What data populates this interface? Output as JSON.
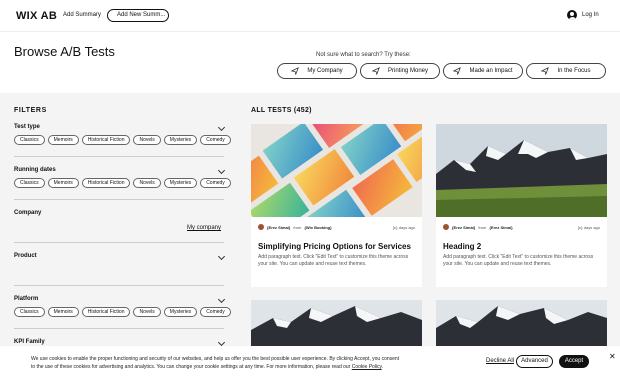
{
  "header": {
    "logo": "WIX AB",
    "add_summary": "Add Summary",
    "add_new_summary": "Add New Summ...",
    "login": "Log In"
  },
  "page": {
    "title": "Browse A/B Tests",
    "suggest_prompt": "Not sure what to search? Try these:",
    "suggestions": [
      "My Company",
      "Printing Money",
      "Made an Impact",
      "In the Focus"
    ]
  },
  "filters": {
    "heading": "FILTERS",
    "test_type": {
      "label": "Test type",
      "tags": [
        "Classics",
        "Memoirs",
        "Historical Fiction",
        "Novels",
        "Mysteries",
        "Comedy"
      ]
    },
    "running_dates": {
      "label": "Running dates",
      "tags": [
        "Classics",
        "Memoirs",
        "Historical Fiction",
        "Novels",
        "Mysteries",
        "Comedy"
      ]
    },
    "company": {
      "label": "Company",
      "my_company": "My company"
    },
    "product": {
      "label": "Product"
    },
    "platform": {
      "label": "Platform",
      "tags": [
        "Classics",
        "Memoirs",
        "Historical Fiction",
        "Novels",
        "Mysteries",
        "Comedy"
      ]
    },
    "kpi_family": {
      "label": "KPI Family"
    }
  },
  "results": {
    "heading": "ALL TESTS (452)",
    "cards": [
      {
        "author": "{Erez Simai}",
        "from": "from",
        "source": "{Wix Booking}",
        "ago": "{n} days ago",
        "title": "Simplifying Pricing Options for Services",
        "text": "Add paragraph text. Click \"Edit Text\" to customize this theme across your site. You can update and reuse text themes."
      },
      {
        "author": "{Erez Simai}",
        "from": "from",
        "source": "{Erez Simai}",
        "ago": "{n} days ago",
        "title": "Heading 2",
        "text": "Add paragraph text. Click \"Edit Text\" to customize this theme across your site. You can update and reuse text themes."
      }
    ]
  },
  "cookie": {
    "line1": "We use cookies to enable the proper functioning and security of our websites, and help us offer you the best possible user experience. By clicking Accept, you consent",
    "line2": "to the use of these cookies for advertising and analytics. You can change your cookie settings at any time. For more information, please read our",
    "policy": "Cookie Policy",
    "period": ".",
    "decline": "Decline All",
    "advanced": "Advanced",
    "accept": "Accept",
    "close": "✕"
  },
  "colors": {
    "accent": "#111111",
    "panel": "#f4f4f4"
  },
  "icons": {
    "suggestion": "send-arrow-icon",
    "login": "user-avatar-icon",
    "section": "chevron-down-icon"
  }
}
